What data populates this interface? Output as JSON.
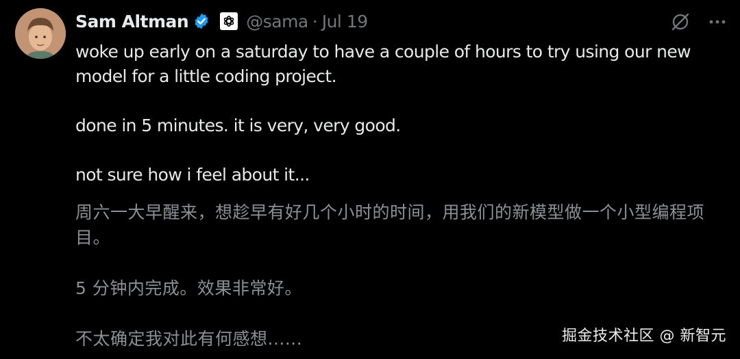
{
  "author": {
    "name": "Sam Altman",
    "handle": "@sama",
    "date": "Jul 19",
    "separator": "·"
  },
  "tweet": {
    "en_lines": [
      "woke up early on a saturday to have a couple of hours to try using our new model for a little coding project.",
      "done in 5 minutes. it is very, very good.",
      "not sure how i feel about it..."
    ],
    "zh_lines": [
      "周六一大早醒来，想趁早有好几个小时的时间，用我们的新模型做一个小型编程项目。",
      "5 分钟内完成。效果非常好。",
      "不太确定我对此有何感想......"
    ]
  },
  "watermark": "掘金技术社区 @ 新智元",
  "icons": {
    "verified": "verified-badge-icon",
    "affiliate": "openai-logo-icon",
    "grok": "grok-icon",
    "more": "more-icon"
  },
  "colors": {
    "background": "#000000",
    "text": "#e7e9ea",
    "secondary": "#71767b",
    "verified": "#1d9bf0"
  }
}
